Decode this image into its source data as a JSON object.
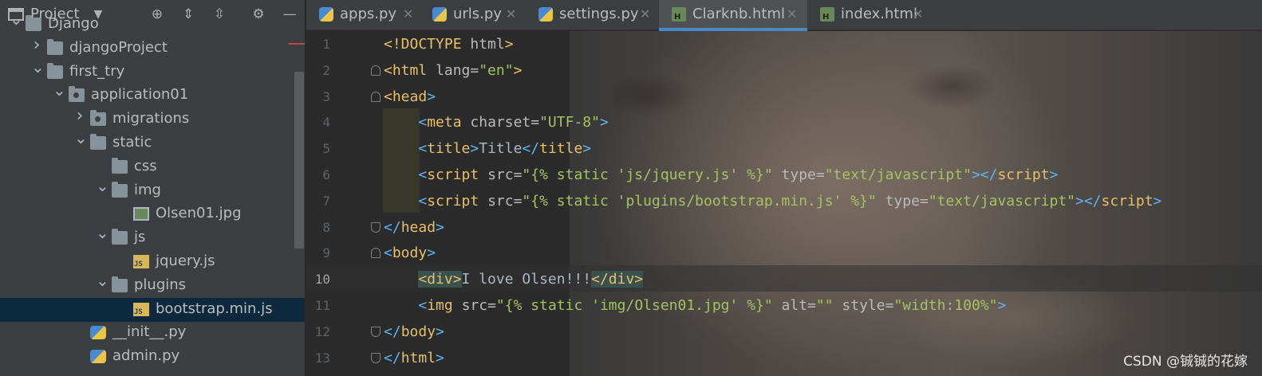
{
  "project_panel": {
    "title": "Project",
    "tree": [
      {
        "label": "Django",
        "kind": "folder",
        "depth": 1,
        "arrow": "down"
      },
      {
        "label": "djangoProject",
        "kind": "folder",
        "depth": 2,
        "arrow": "right"
      },
      {
        "label": "first_try",
        "kind": "folder",
        "depth": 2,
        "arrow": "down"
      },
      {
        "label": "application01",
        "kind": "package",
        "depth": 3,
        "arrow": "down"
      },
      {
        "label": "migrations",
        "kind": "package",
        "depth": 4,
        "arrow": "right"
      },
      {
        "label": "static",
        "kind": "folder",
        "depth": 4,
        "arrow": "down"
      },
      {
        "label": "css",
        "kind": "folder",
        "depth": 5,
        "arrow": "none"
      },
      {
        "label": "img",
        "kind": "folder",
        "depth": 5,
        "arrow": "down"
      },
      {
        "label": "Olsen01.jpg",
        "kind": "image",
        "depth": 6,
        "arrow": "none"
      },
      {
        "label": "js",
        "kind": "folder",
        "depth": 5,
        "arrow": "down"
      },
      {
        "label": "jquery.js",
        "kind": "js",
        "depth": 6,
        "arrow": "none"
      },
      {
        "label": "plugins",
        "kind": "folder",
        "depth": 5,
        "arrow": "down"
      },
      {
        "label": "bootstrap.min.js",
        "kind": "js",
        "depth": 6,
        "arrow": "none",
        "selected": true
      },
      {
        "label": "__init__.py",
        "kind": "py",
        "depth": 4,
        "arrow": "none"
      },
      {
        "label": "admin.py",
        "kind": "py",
        "depth": 4,
        "arrow": "none"
      }
    ]
  },
  "tabs": [
    {
      "label": "apps.py",
      "icon": "python-file-icon"
    },
    {
      "label": "urls.py",
      "icon": "python-file-icon"
    },
    {
      "label": "settings.py",
      "icon": "python-file-icon"
    },
    {
      "label": "Clarknb.html",
      "icon": "html-file-icon",
      "active": true
    },
    {
      "label": "index.html",
      "icon": "html-file-icon"
    }
  ],
  "editor": {
    "current_line": 10,
    "lines": [
      {
        "n": "1",
        "tokens": [
          [
            "doc",
            "<!DOCTYPE "
          ],
          [
            "attr",
            "html"
          ],
          [
            "doc",
            ">"
          ]
        ]
      },
      {
        "n": "2",
        "fold": "up",
        "tokens": [
          [
            "tag",
            "<html "
          ],
          [
            "attr",
            "lang="
          ],
          [
            "val",
            "\"en\""
          ],
          [
            "tag",
            ">"
          ]
        ]
      },
      {
        "n": "3",
        "fold": "up",
        "tokens": [
          [
            "tag",
            "<head"
          ],
          [
            "br",
            ">"
          ]
        ]
      },
      {
        "n": "4",
        "tokens": [
          [
            "txt",
            "    "
          ],
          [
            "br",
            "<"
          ],
          [
            "tag",
            "meta "
          ],
          [
            "attr",
            "charset="
          ],
          [
            "val",
            "\"UTF-8\""
          ],
          [
            "br",
            ">"
          ]
        ]
      },
      {
        "n": "5",
        "tokens": [
          [
            "txt",
            "    "
          ],
          [
            "br",
            "<"
          ],
          [
            "tag",
            "title"
          ],
          [
            "br",
            ">"
          ],
          [
            "txt",
            "Title"
          ],
          [
            "br",
            "</"
          ],
          [
            "tag",
            "title"
          ],
          [
            "br",
            ">"
          ]
        ]
      },
      {
        "n": "6",
        "tokens": [
          [
            "txt",
            "    "
          ],
          [
            "br",
            "<"
          ],
          [
            "tag",
            "script "
          ],
          [
            "attr",
            "src="
          ],
          [
            "val",
            "\"{% static 'js/jquery.js' %}\" "
          ],
          [
            "attr",
            "type="
          ],
          [
            "val",
            "\"text/javascript\""
          ],
          [
            "br",
            "></"
          ],
          [
            "tag",
            "script"
          ],
          [
            "br",
            ">"
          ]
        ]
      },
      {
        "n": "7",
        "tokens": [
          [
            "txt",
            "    "
          ],
          [
            "br",
            "<"
          ],
          [
            "tag",
            "script "
          ],
          [
            "attr",
            "src="
          ],
          [
            "val",
            "\"{% static 'plugins/bootstrap.min.js' %}\" "
          ],
          [
            "attr",
            "type="
          ],
          [
            "val",
            "\"text/javascript\""
          ],
          [
            "br",
            "></"
          ],
          [
            "tag",
            "script"
          ],
          [
            "br",
            ">"
          ]
        ]
      },
      {
        "n": "8",
        "fold": "down",
        "tokens": [
          [
            "br",
            "</"
          ],
          [
            "tag",
            "head"
          ],
          [
            "br",
            ">"
          ]
        ]
      },
      {
        "n": "9",
        "fold": "up",
        "tokens": [
          [
            "br",
            "<"
          ],
          [
            "tag",
            "body"
          ],
          [
            "br",
            ">"
          ]
        ]
      },
      {
        "n": "10",
        "tokens": [
          [
            "txt",
            "    "
          ],
          [
            "hltag",
            "<div>"
          ],
          [
            "txt",
            "I love Olsen!!!"
          ],
          [
            "hltag",
            "</div>"
          ]
        ]
      },
      {
        "n": "11",
        "tokens": [
          [
            "txt",
            "    "
          ],
          [
            "br",
            "<"
          ],
          [
            "tag",
            "img "
          ],
          [
            "attr",
            "src="
          ],
          [
            "val",
            "\"{% static 'img/Olsen01.jpg' %}\" "
          ],
          [
            "attr",
            "alt="
          ],
          [
            "val",
            "\"\" "
          ],
          [
            "attr",
            "style="
          ],
          [
            "val",
            "\"width:100%\""
          ],
          [
            "br",
            ">"
          ]
        ]
      },
      {
        "n": "12",
        "fold": "down",
        "tokens": [
          [
            "br",
            "</"
          ],
          [
            "tag",
            "body"
          ],
          [
            "br",
            ">"
          ]
        ]
      },
      {
        "n": "13",
        "fold": "down",
        "tokens": [
          [
            "br",
            "</"
          ],
          [
            "tag",
            "html"
          ],
          [
            "br",
            ">"
          ]
        ]
      }
    ]
  },
  "watermark": "CSDN @铖铖的花嫁"
}
